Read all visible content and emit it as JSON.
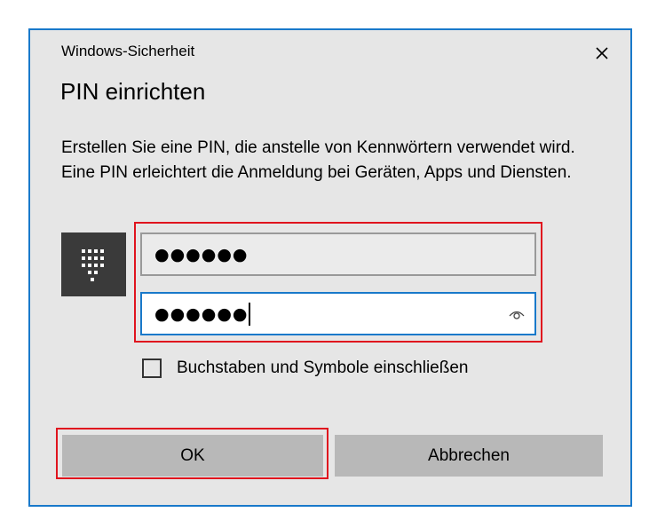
{
  "window": {
    "title": "Windows-Sicherheit",
    "close_icon": "close-icon"
  },
  "dialog": {
    "heading": "PIN einrichten",
    "description": "Erstellen Sie eine PIN, die anstelle von Kennwörtern verwendet wird. Eine PIN erleichtert die Anmeldung bei Geräten, Apps und Diensten.",
    "pin_icon": "keypad-icon",
    "new_pin": {
      "masked_value": "●●●●●●"
    },
    "confirm_pin": {
      "masked_value": "●●●●●●",
      "reveal_icon": "eye-icon"
    },
    "checkbox": {
      "label": "Buchstaben und Symbole einschließen",
      "checked": false
    },
    "buttons": {
      "ok_label": "OK",
      "cancel_label": "Abbrechen"
    }
  },
  "colors": {
    "accent": "#1979ca",
    "annotation": "#e0141e",
    "dialog_background": "#e6e6e6",
    "button_background": "#b8b8b8",
    "icon_tile": "#3a3a3a"
  }
}
